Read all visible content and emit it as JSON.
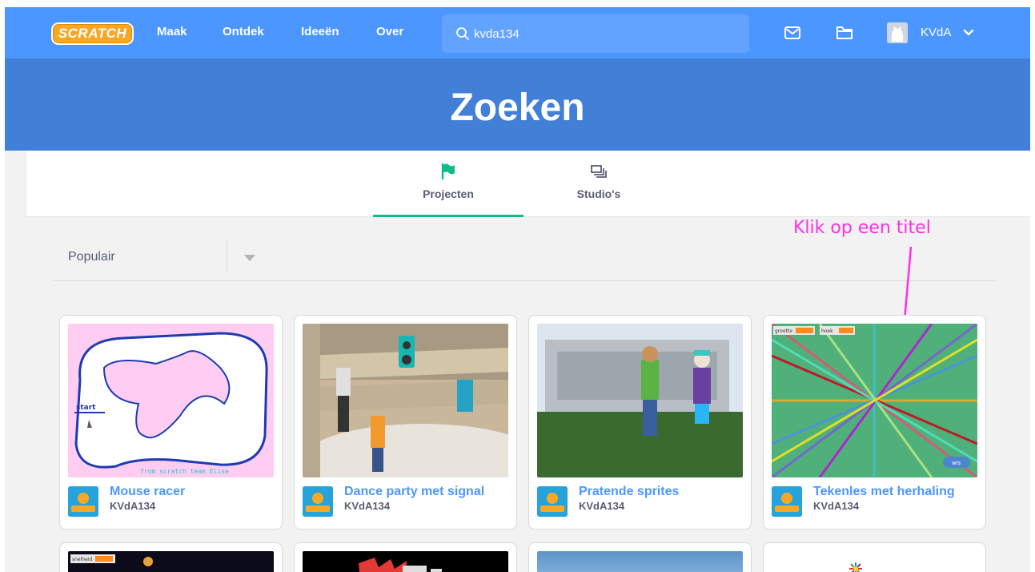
{
  "nav": {
    "logo": "SCRATCH",
    "links": [
      "Maak",
      "Ontdek",
      "Ideeën",
      "Over"
    ],
    "search_value": "kvda134",
    "user": "KVdA",
    "icons": [
      "messages-icon",
      "my-stuff-folder-icon",
      "chevron-down-icon"
    ]
  },
  "banner": {
    "title": "Zoeken"
  },
  "tabs": [
    {
      "label": "Projecten",
      "icon": "flag-icon",
      "active": true
    },
    {
      "label": "Studio's",
      "icon": "studio-icon",
      "active": false
    }
  ],
  "sort": {
    "selected": "Populair"
  },
  "annotation": {
    "text": "Klik op een titel"
  },
  "projects": [
    {
      "title": "Mouse racer",
      "author": "KVdA134"
    },
    {
      "title": "Dance party met signal",
      "author": "KVdA134"
    },
    {
      "title": "Pratende sprites",
      "author": "KVdA134"
    },
    {
      "title": "Tekenles met herhaling",
      "author": "KVdA134"
    }
  ],
  "thumb_text": {
    "racer_start": "start",
    "racer_credit": "from scratch team Elise",
    "tekenles_var1": "grootte",
    "tekenles_var2": "hoek",
    "tekenles_button": "wis",
    "partial_var": "snelheid"
  },
  "colors": {
    "nav": "#4c97ff",
    "banner": "#4280d7",
    "tab_active": "#0fbd8c",
    "link": "#4c97ff",
    "annotation": "#ff2fe6"
  }
}
